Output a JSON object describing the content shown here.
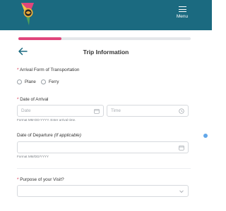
{
  "header": {
    "menu_label": "Menu",
    "logo_icon": "parrot-logo-icon",
    "background_color": "#1b6a80"
  },
  "progress": {
    "fraction": 0.25,
    "fill_color": "#e0457b"
  },
  "page": {
    "title": "Trip Information",
    "back_icon": "arrow-left-icon"
  },
  "arrival_form": {
    "label": "Arrival Form of Transportation",
    "required_mark": "*",
    "options": [
      {
        "label": "Plane"
      },
      {
        "label": "Ferry"
      }
    ]
  },
  "date_of_arrival": {
    "label": "Date of Arrival",
    "required_mark": "*",
    "date_placeholder": "Date",
    "time_placeholder": "Time",
    "hint": "Format MM-DD-YYYY. Enter arrival time."
  },
  "date_of_departure": {
    "label": "Date of Departure",
    "label_note": "(If applicable)",
    "hint": "Format MM/DD/YYYY"
  },
  "purpose": {
    "label": "Purpose of your Visit?",
    "required_mark": "*"
  }
}
